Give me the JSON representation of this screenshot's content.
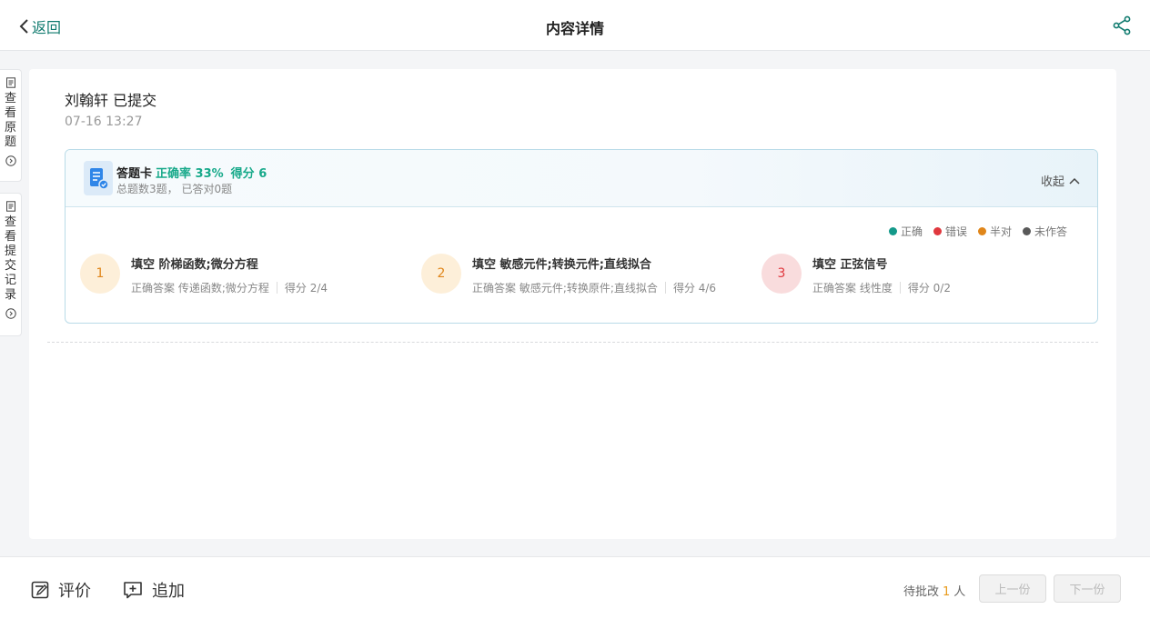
{
  "header": {
    "back_label": "返回",
    "title": "内容详情",
    "share_icon": "share-icon"
  },
  "side_tabs": [
    {
      "label": "查看原题",
      "icon": "document-icon"
    },
    {
      "label": "查看提交记录",
      "icon": "document-icon"
    }
  ],
  "submission": {
    "student_status": "刘翰轩 已提交",
    "time": "07-16 13:27"
  },
  "answer_card": {
    "title": "答题卡",
    "accuracy": "正确率 33%",
    "score": "得分 6",
    "summary": "总题数3题， 已答对0题",
    "collapse_label": "收起"
  },
  "legend": [
    {
      "label": "正确",
      "color": "#14998a"
    },
    {
      "label": "错误",
      "color": "#e0383e"
    },
    {
      "label": "半对",
      "color": "#e0861a"
    },
    {
      "label": "未作答",
      "color": "#595959"
    }
  ],
  "questions": [
    {
      "number": "1",
      "title": "填空 阶梯函数;微分方程",
      "answer_label": "正确答案",
      "answer": "传递函数;微分方程",
      "score": "得分 2/4",
      "status": "半对",
      "bg": "#fdefd9",
      "fg": "#e0861a"
    },
    {
      "number": "2",
      "title": "填空 敏感元件;转换元件;直线拟合",
      "answer_label": "正确答案",
      "answer": "敏感元件;转换原件;直线拟合",
      "score": "得分 4/6",
      "status": "半对",
      "bg": "#fdefd9",
      "fg": "#e0861a"
    },
    {
      "number": "3",
      "title": "填空 正弦信号",
      "answer_label": "正确答案",
      "answer": "线性度",
      "score": "得分 0/2",
      "status": "错误",
      "bg": "#f9dcdd",
      "fg": "#e0383e"
    }
  ],
  "footer": {
    "comment_label": "评价",
    "add_label": "追加",
    "pending_prefix": "待批改",
    "pending_count": "1",
    "pending_suffix": "人",
    "prev_label": "上一份",
    "next_label": "下一份"
  },
  "colors": {
    "brand": "#0f7a6e",
    "accent_green": "#17a98a"
  }
}
